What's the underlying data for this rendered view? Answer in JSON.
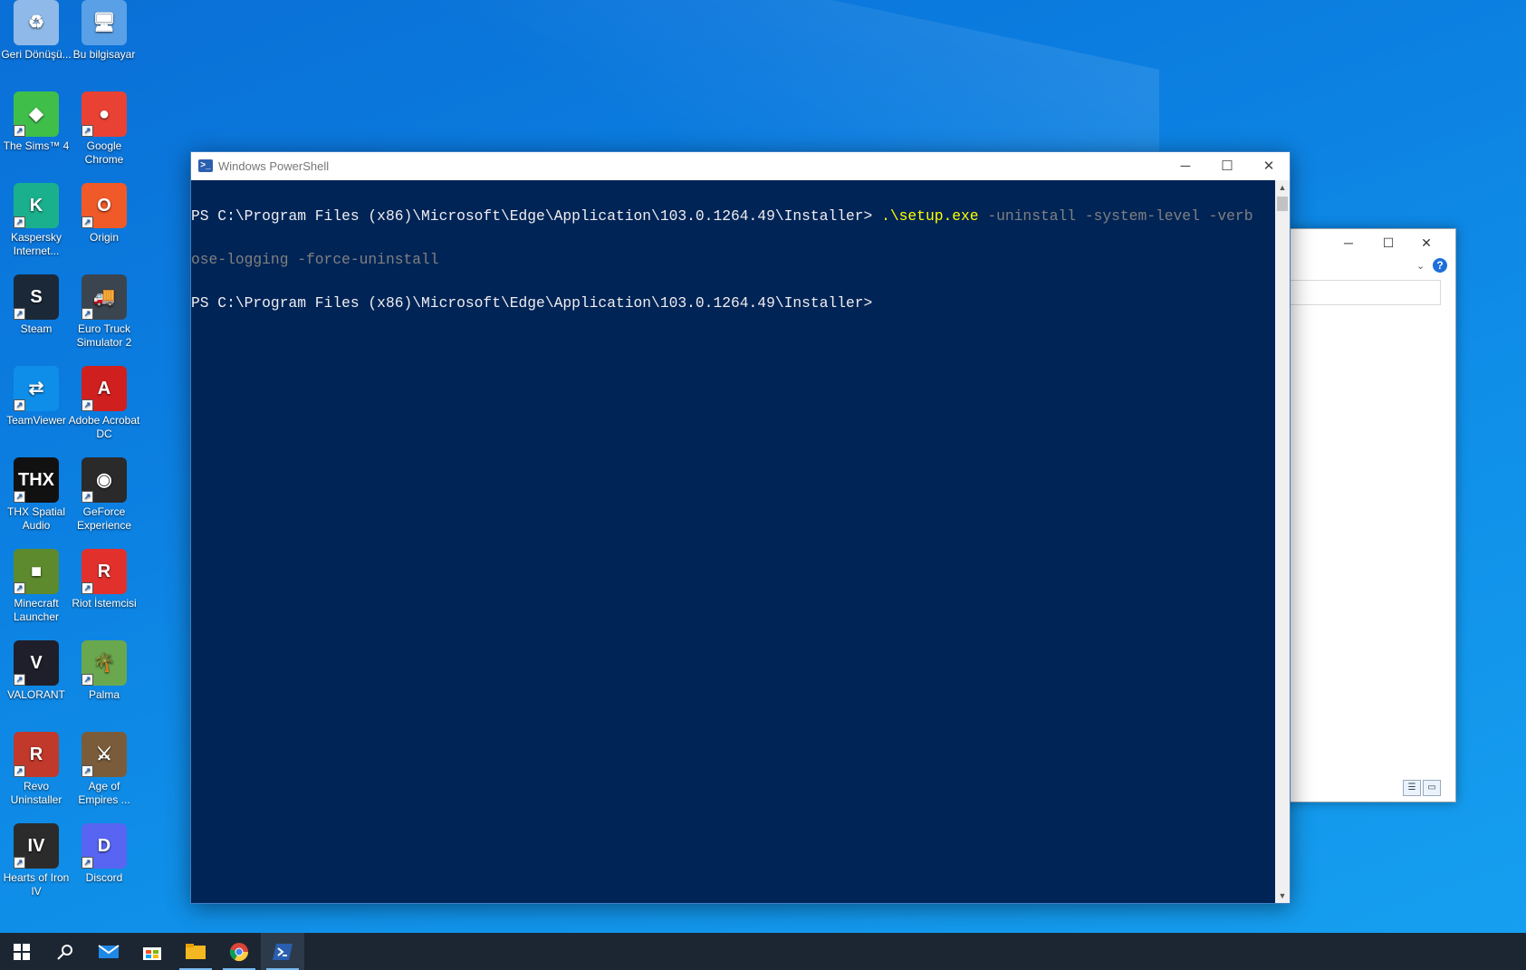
{
  "desktop": {
    "icons": [
      {
        "label": "Geri Dönüşü...",
        "symbol": "♻",
        "color": "#8fb9e8"
      },
      {
        "label": "Bu bilgisayar",
        "symbol": "🖥",
        "color": "#5aa0e6"
      },
      {
        "label": "The Sims™ 4",
        "symbol": "◆",
        "color": "#3fbf4a"
      },
      {
        "label": "Google Chrome",
        "symbol": "●",
        "color": "#e94235"
      },
      {
        "label": "Kaspersky Internet...",
        "symbol": "K",
        "color": "#1bb08d"
      },
      {
        "label": "Origin",
        "symbol": "O",
        "color": "#f05a28"
      },
      {
        "label": "Steam",
        "symbol": "S",
        "color": "#1b2838"
      },
      {
        "label": "Euro Truck Simulator 2",
        "symbol": "🚚",
        "color": "#3b4550"
      },
      {
        "label": "TeamViewer",
        "symbol": "⇄",
        "color": "#0e8ee9"
      },
      {
        "label": "Adobe Acrobat DC",
        "symbol": "A",
        "color": "#d01f1f"
      },
      {
        "label": "THX Spatial Audio",
        "symbol": "THX",
        "color": "#111111"
      },
      {
        "label": "GeForce Experience",
        "symbol": "◉",
        "color": "#2a2a2a"
      },
      {
        "label": "Minecraft Launcher",
        "symbol": "■",
        "color": "#5c8a2c"
      },
      {
        "label": "Riot İstemcisi",
        "symbol": "R",
        "color": "#e2312d"
      },
      {
        "label": "VALORANT",
        "symbol": "V",
        "color": "#1f1f2b"
      },
      {
        "label": "Palma",
        "symbol": "🌴",
        "color": "#6aa84f"
      },
      {
        "label": "Revo Uninstaller",
        "symbol": "R",
        "color": "#c0392b"
      },
      {
        "label": "Age of Empires ...",
        "symbol": "⚔",
        "color": "#7a5c3a"
      },
      {
        "label": "Hearts of Iron IV",
        "symbol": "IV",
        "color": "#2b2b2b"
      },
      {
        "label": "Discord",
        "symbol": "D",
        "color": "#5865f2"
      }
    ]
  },
  "powershell": {
    "title": "Windows PowerShell",
    "line1_prompt": "PS C:\\Program Files (x86)\\Microsoft\\Edge\\Application\\103.0.1264.49\\Installer> ",
    "line1_cmd": ".\\setup.exe",
    "line1_params": " -uninstall -system-level -verb",
    "line2_params": "ose-logging -force-uninstall",
    "line3_prompt": "PS C:\\Program Files (x86)\\Microsoft\\Edge\\Application\\103.0.1264.49\\Installer>",
    "btn_minimize": "─",
    "btn_maximize": "☐",
    "btn_close": "✕",
    "icon_glyph": ">_",
    "bg_color": "#012456",
    "cmd_color": "#ffff00",
    "param_color": "#808080"
  },
  "bg_window": {
    "btn_minimize": "─",
    "btn_maximize": "☐",
    "btn_close": "✕",
    "chevron": "⌄",
    "help": "?"
  },
  "taskbar": {
    "items": [
      {
        "name": "start-icon"
      },
      {
        "name": "search-icon"
      },
      {
        "name": "mail-icon"
      },
      {
        "name": "store-icon"
      },
      {
        "name": "file-explorer-icon"
      },
      {
        "name": "chrome-icon"
      },
      {
        "name": "powershell-icon"
      }
    ],
    "color": "#1c2633",
    "accent": "#76b9ed"
  }
}
